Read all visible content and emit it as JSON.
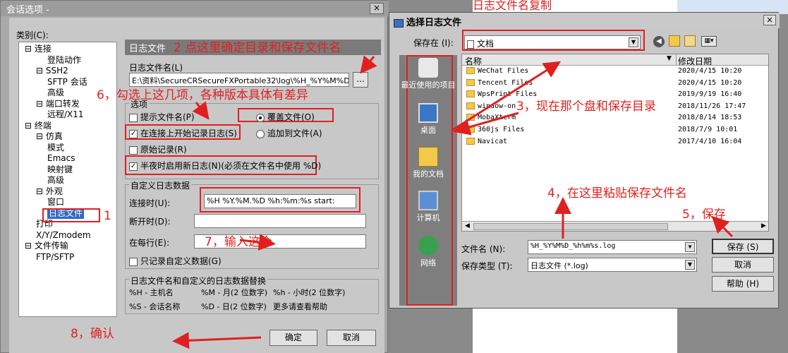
{
  "session_dialog": {
    "title": "会话选项 -",
    "close": "×",
    "category_label": "类别(C):",
    "tree": [
      "⊟ 连接",
      "登陆动作",
      "⊟ SSH2",
      "SFTP 会话",
      "高级",
      "⊟ 端口转发",
      "远程/X11",
      "⊟ 终端",
      "⊟ 仿真",
      "模式",
      "Emacs",
      "映射键",
      "高级",
      "⊟ 外观",
      "窗口",
      "日志文件",
      "打印",
      "X/Y/Zmodem",
      "⊟ 文件传输",
      "FTP/SFTP"
    ],
    "section_title": "日志文件",
    "log_file_name_label": "日志文件名(L)",
    "log_file_path": "E:\\资料\\SecureCRSecureFXPortable32\\log\\%H_%Y%M%D_%h%",
    "browse_button": "...",
    "options_label": "选项",
    "opt_prompt_filename": "提示文件名(P)",
    "opt_overwrite": "覆盖文件(O)",
    "opt_start_on_connect": "在连接上开始记录日志(S)",
    "opt_append": "追加到文件(A)",
    "opt_raw_log": "原始记录(R)",
    "opt_midnight": "半夜时启用新日志(N)(必须在文件名中使用 %D)",
    "custom_log_label": "自定义日志数据",
    "on_connect_label": "连接时(U):",
    "on_connect_value": "%H      %Y.%M.%D   %h:%m:%s  start:",
    "on_disconnect_label": "断开时(D):",
    "each_line_label": "在每行(E):",
    "only_custom_label": "只记录自定义数据(G)",
    "subst_label": "日志文件名和自定义的日志数据替换",
    "subst_1": "%H - 主机名",
    "subst_2": "%M - 月(2 位数字)",
    "subst_3": "%h - 小时(2 位数字)",
    "subst_4": "%S - 会话名称",
    "subst_5": "%D - 日(2 位数字)",
    "subst_6": "更多请查看帮助",
    "ok_button": "确定",
    "cancel_button": "取消"
  },
  "log_dialog": {
    "title": "选择日志文件",
    "close": "×",
    "save_in_label": "保存在 (I):",
    "save_in_value": "文档",
    "places": [
      "最近使用的项目",
      "桌面",
      "我的文档",
      "计算机",
      "网络"
    ],
    "col_name": "名称",
    "col_modified": "修改日期",
    "files": [
      {
        "name": "WeChat Files",
        "date": "2020/4/15 10:20"
      },
      {
        "name": "Tencent Files",
        "date": "2020/4/15 10:20"
      },
      {
        "name": "WpsPrint Files",
        "date": "2019/9/19 16:40"
      },
      {
        "name": "window-on",
        "date": "2018/11/26 17:47"
      },
      {
        "name": "MobaXterm",
        "date": "2018/8/14 18:53"
      },
      {
        "name": "360js Files",
        "date": "2018/7/9 10:01"
      },
      {
        "name": "Navicat",
        "date": "2017/4/10 16:04"
      }
    ],
    "filename_label": "文件名 (N):",
    "filename_value": "%H_%Y%M%D_%h%m%s.log",
    "filetype_label": "保存类型 (T):",
    "filetype_value": "日志文件 (*.log)",
    "save_button": "保存 (S)",
    "cancel_button": "取消",
    "help_button": "帮助 (H)"
  },
  "annotations": {
    "a1": "1",
    "a2": "2 点这里确定目录和保存文件名",
    "a3": "3，现在那个盘和保存目录",
    "a4": "4，在这里粘贴保存文件名",
    "a5": "5，保存",
    "a6": "6，勾选上这几项，各种版本具体有差异",
    "a7": "7，输入这个",
    "a8": "8，确认",
    "top": "日志文件名复制"
  },
  "colors": {
    "annotation": "#e02020",
    "selection": "#316ac5"
  }
}
